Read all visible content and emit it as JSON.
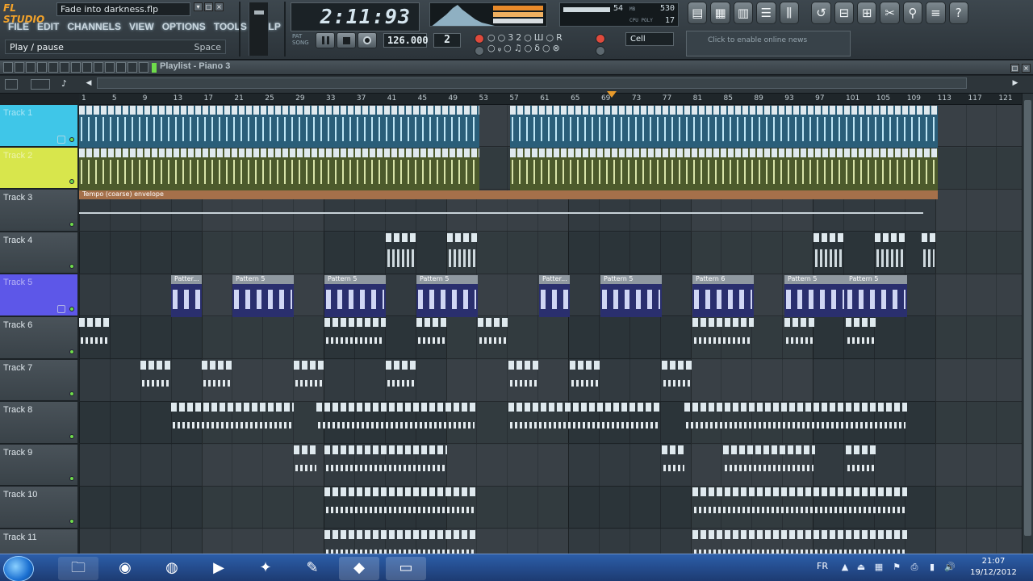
{
  "app": {
    "logo": "FL STUDIO",
    "filename": "Fade into darkness.flp",
    "menu": [
      "FILE",
      "EDIT",
      "CHANNELS",
      "VIEW",
      "OPTIONS",
      "TOOLS",
      "HELP"
    ],
    "hint": "Play / pause",
    "hint_key": "Space"
  },
  "transport": {
    "time": "2:11:93",
    "bpm": "126.000",
    "pattern": "2",
    "snap": "Cell",
    "mem": "54",
    "cpu": "530",
    "poly": "17",
    "news": "Click to enable online news"
  },
  "playlist": {
    "title": "Playlist - Piano 3",
    "bars": [
      "1",
      "5",
      "9",
      "13",
      "17",
      "21",
      "25",
      "29",
      "33",
      "37",
      "41",
      "45",
      "49",
      "53",
      "57",
      "61",
      "65",
      "69",
      "73",
      "77",
      "81",
      "85",
      "89",
      "93",
      "97",
      "101",
      "105",
      "109",
      "113",
      "117",
      "121"
    ],
    "tracks": [
      {
        "name": "Track 1",
        "color": "#3fc6e8"
      },
      {
        "name": "Track 2",
        "color": "#d8e64c"
      },
      {
        "name": "Track 3",
        "color": ""
      },
      {
        "name": "Track 4",
        "color": ""
      },
      {
        "name": "Track 5",
        "color": "#5d57e8"
      },
      {
        "name": "Track 6",
        "color": ""
      },
      {
        "name": "Track 7",
        "color": ""
      },
      {
        "name": "Track 8",
        "color": ""
      },
      {
        "name": "Track 9",
        "color": ""
      },
      {
        "name": "Track 10",
        "color": ""
      },
      {
        "name": "Track 11",
        "color": ""
      }
    ],
    "clip_labels": {
      "tempo": "Tempo (coarse) envelope",
      "pattern5": "Pattern 5",
      "pattern6": "Pattern 6",
      "pattern_short": "Patter..."
    }
  },
  "taskbar": {
    "lang": "FR",
    "time": "21:07",
    "date": "19/12/2012",
    "apps": [
      "explorer",
      "chrome",
      "internet",
      "media-player",
      "messenger",
      "paint",
      "fl-studio",
      "window"
    ]
  }
}
